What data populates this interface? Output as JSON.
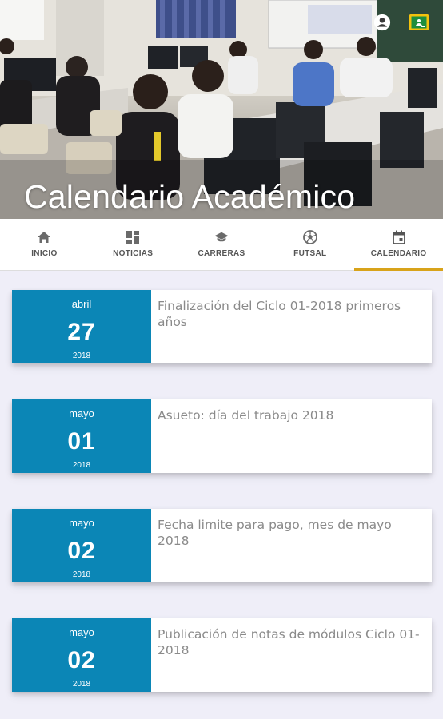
{
  "header": {
    "title": "Calendario Académico",
    "actions": [
      {
        "icon": "account-circle-icon"
      },
      {
        "icon": "classroom-icon"
      }
    ]
  },
  "tabs": [
    {
      "label": "INICIO",
      "icon": "home-icon"
    },
    {
      "label": "NOTICIAS",
      "icon": "dashboard-icon"
    },
    {
      "label": "CARRERAS",
      "icon": "graduation-cap-icon"
    },
    {
      "label": "FUTSAL",
      "icon": "soccer-ball-icon"
    },
    {
      "label": "CALENDARIO",
      "icon": "calendar-icon",
      "active": true
    }
  ],
  "events": [
    {
      "month": "abril",
      "day": "27",
      "year": "2018",
      "title": "Finalización del Ciclo 01-2018 primeros años"
    },
    {
      "month": "mayo",
      "day": "01",
      "year": "2018",
      "title": "Asueto: día del trabajo 2018"
    },
    {
      "month": "mayo",
      "day": "02",
      "year": "2018",
      "title": "Fecha limite para pago, mes de mayo 2018"
    },
    {
      "month": "mayo",
      "day": "02",
      "year": "2018",
      "title": "Publicación de notas de módulos Ciclo 01-2018"
    }
  ],
  "colors": {
    "date_block": "#0b86b6",
    "tab_indicator": "#d8a31a",
    "background": "#efeef8"
  }
}
